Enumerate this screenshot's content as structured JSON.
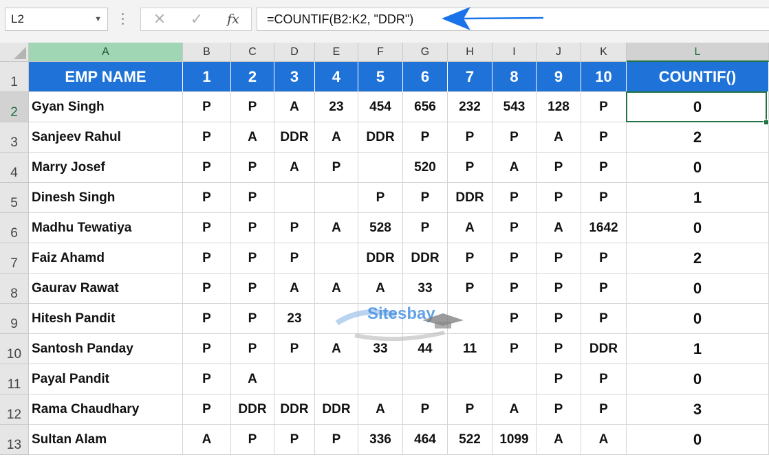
{
  "formula_bar": {
    "name_box": "L2",
    "cancel_icon": "✕",
    "enter_icon": "✓",
    "fx_label": "fx",
    "formula": "=COUNTIF(B2:K2, \"DDR\")"
  },
  "columns": [
    "A",
    "B",
    "C",
    "D",
    "E",
    "F",
    "G",
    "H",
    "I",
    "J",
    "K",
    "L"
  ],
  "selected_column": "L",
  "row_numbers": [
    "1",
    "2",
    "3",
    "4",
    "5",
    "6",
    "7",
    "8",
    "9",
    "10",
    "11",
    "12",
    "13"
  ],
  "header_row": [
    "EMP NAME",
    "1",
    "2",
    "3",
    "4",
    "5",
    "6",
    "7",
    "8",
    "9",
    "10",
    "COUNTIF()"
  ],
  "rows": [
    {
      "name": "Gyan Singh",
      "values": [
        "P",
        "P",
        "A",
        "23",
        "454",
        "656",
        "232",
        "543",
        "128",
        "P"
      ],
      "count": "0"
    },
    {
      "name": "Sanjeev Rahul",
      "values": [
        "P",
        "A",
        "DDR",
        "A",
        "DDR",
        "P",
        "P",
        "P",
        "A",
        "P"
      ],
      "count": "2"
    },
    {
      "name": "Marry Josef",
      "values": [
        "P",
        "P",
        "A",
        "P",
        "",
        "520",
        "P",
        "A",
        "P",
        "P"
      ],
      "count": "0"
    },
    {
      "name": "Dinesh Singh",
      "values": [
        "P",
        "P",
        "",
        "",
        "P",
        "P",
        "DDR",
        "P",
        "P",
        "P"
      ],
      "count": "1"
    },
    {
      "name": "Madhu Tewatiya",
      "values": [
        "P",
        "P",
        "P",
        "A",
        "528",
        "P",
        "A",
        "P",
        "A",
        "1642"
      ],
      "count": "0"
    },
    {
      "name": "Faiz Ahamd",
      "values": [
        "P",
        "P",
        "P",
        "",
        "DDR",
        "DDR",
        "P",
        "P",
        "P",
        "P"
      ],
      "count": "2"
    },
    {
      "name": "Gaurav Rawat",
      "values": [
        "P",
        "P",
        "A",
        "A",
        "A",
        "33",
        "P",
        "P",
        "P",
        "P"
      ],
      "count": "0"
    },
    {
      "name": "Hitesh Pandit",
      "values": [
        "P",
        "P",
        "23",
        "",
        "",
        "",
        "",
        "P",
        "P",
        "P"
      ],
      "count": "0"
    },
    {
      "name": "Santosh Panday",
      "values": [
        "P",
        "P",
        "P",
        "A",
        "33",
        "44",
        "11",
        "P",
        "P",
        "DDR"
      ],
      "count": "1"
    },
    {
      "name": "Payal Pandit",
      "values": [
        "P",
        "A",
        "",
        "",
        "",
        "",
        "",
        "",
        "P",
        "P"
      ],
      "count": "0"
    },
    {
      "name": "Rama Chaudhary",
      "values": [
        "P",
        "DDR",
        "DDR",
        "DDR",
        "A",
        "P",
        "P",
        "A",
        "P",
        "P"
      ],
      "count": "3"
    },
    {
      "name": "Sultan Alam",
      "values": [
        "A",
        "P",
        "P",
        "P",
        "336",
        "464",
        "522",
        "1099",
        "A",
        "A"
      ],
      "count": "0"
    }
  ],
  "watermark": "Sitesbay",
  "colors": {
    "header_fill": "#1f73d8",
    "selection": "#217346",
    "arrow": "#1a73e8"
  },
  "icons": {
    "name_box_dropdown": "chevron-down-icon",
    "cancel": "close-icon",
    "enter": "check-icon",
    "function": "fx-icon",
    "arrow": "arrow-left-icon"
  }
}
